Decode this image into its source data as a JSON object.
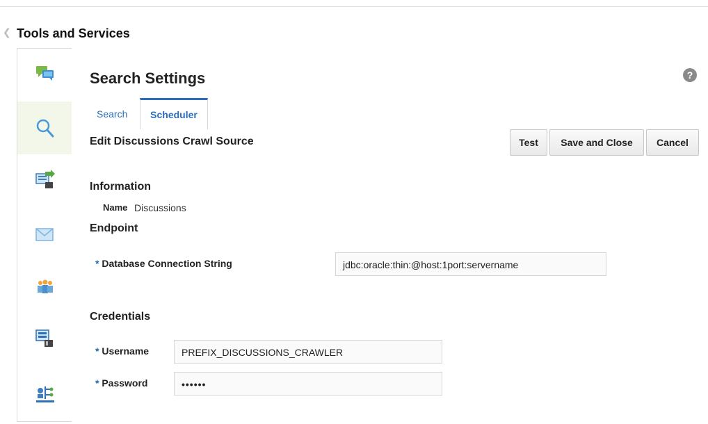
{
  "app": {
    "title": "Tools and Services"
  },
  "page": {
    "title": "Search Settings"
  },
  "tabs": [
    {
      "label": "Search"
    },
    {
      "label": "Scheduler"
    }
  ],
  "form": {
    "heading": "Edit Discussions Crawl Source",
    "buttons": {
      "test": "Test",
      "save": "Save and Close",
      "cancel": "Cancel"
    },
    "information": {
      "heading": "Information",
      "name_label": "Name",
      "name_value": "Discussions"
    },
    "endpoint": {
      "heading": "Endpoint",
      "required_marker": "*",
      "db_label": "Database Connection String",
      "db_value": "jdbc:oracle:thin:@host:1port:servername"
    },
    "credentials": {
      "heading": "Credentials",
      "username_label": "Username",
      "username_value": "PREFIX_DISCUSSIONS_CRAWLER",
      "password_label": "Password",
      "password_value": "••••••"
    }
  },
  "sidebar": {
    "items": [
      {
        "icon": "chat-icon"
      },
      {
        "icon": "search-icon"
      },
      {
        "icon": "export-icon"
      },
      {
        "icon": "mail-icon"
      },
      {
        "icon": "people-icon"
      },
      {
        "icon": "server-icon"
      },
      {
        "icon": "network-icon"
      }
    ]
  },
  "colors": {
    "accent": "#2a6ebb",
    "active_sidebar": "#f3f7e9"
  }
}
